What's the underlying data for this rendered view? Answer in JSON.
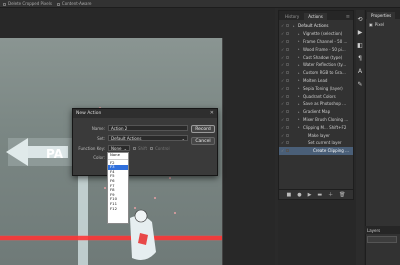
{
  "optbar": {
    "items": [
      "Delete Cropped Pixels",
      "Content-Aware"
    ]
  },
  "actions_panel": {
    "tabs": [
      "History",
      "Actions"
    ],
    "rows": [
      {
        "label": "Default Actions",
        "level": 0,
        "type": "set"
      },
      {
        "label": "Vignette (selection)",
        "level": 1
      },
      {
        "label": "Frame Channel - 50 ...",
        "level": 1
      },
      {
        "label": "Wood Frame - 50 pi...",
        "level": 1
      },
      {
        "label": "Cast Shadow (type)",
        "level": 1
      },
      {
        "label": "Water Reflection (ty...",
        "level": 1
      },
      {
        "label": "Custom RGB to Gra...",
        "level": 1
      },
      {
        "label": "Molten Lead",
        "level": 1
      },
      {
        "label": "Sepia Toning (layer)",
        "level": 1
      },
      {
        "label": "Quadrant Colors",
        "level": 1
      },
      {
        "label": "Save as Photoshop ...",
        "level": 1
      },
      {
        "label": "Gradient Map",
        "level": 1
      },
      {
        "label": "Mixer Brush Cloning ...",
        "level": 1
      },
      {
        "label": "Clipping M...  Shift+F2",
        "level": 1
      },
      {
        "label": "Make layer",
        "level": 2
      },
      {
        "label": "Set current layer",
        "level": 2
      },
      {
        "label": "Create Clipping ...",
        "level": 3,
        "selected": true
      }
    ],
    "footer_icons": [
      "stop-icon",
      "record-icon",
      "play-icon",
      "new-set-icon",
      "new-action-icon",
      "trash-icon"
    ]
  },
  "properties_panel": {
    "tabs": [
      "Properties"
    ],
    "item_label": "Pixel",
    "layers_label": "Layers"
  },
  "dialog": {
    "title": "New Action",
    "name_label": "Name:",
    "name_value": "Action 2",
    "set_label": "Set:",
    "set_value": "Default Actions",
    "fkey_label": "Function Key:",
    "fkey_value": "None",
    "shift_label": "Shift",
    "control_label": "Control",
    "color_label": "Color:",
    "record_label": "Record",
    "cancel_label": "Cancel"
  },
  "fkey_options": [
    "None",
    "F2",
    "F3",
    "F4",
    "F5",
    "F6",
    "F7",
    "F8",
    "F9",
    "F10",
    "F11",
    "F12"
  ],
  "fkey_highlighted": "F3",
  "colors": {
    "selection": "#4a5f78",
    "dropdown_highlight": "#2f6fdc",
    "laser": "#ff2a2a"
  }
}
